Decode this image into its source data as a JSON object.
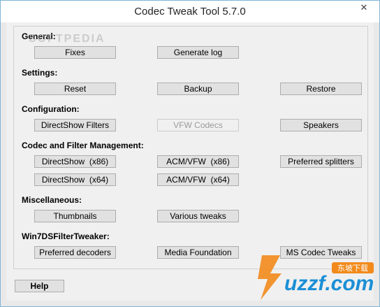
{
  "window": {
    "title": "Codec Tweak Tool 5.7.0",
    "close_glyph": "✕"
  },
  "sections": {
    "general": "General:",
    "settings": "Settings:",
    "configuration": "Configuration:",
    "codec_filter": "Codec and Filter Management:",
    "misc": "Miscellaneous:",
    "win7ds": "Win7DSFilterTweaker:"
  },
  "buttons": {
    "fixes": "Fixes",
    "generate_log": "Generate log",
    "reset": "Reset",
    "backup": "Backup",
    "restore": "Restore",
    "directshow_filters": "DirectShow Filters",
    "vfw_codecs": "VFW Codecs",
    "speakers": "Speakers",
    "directshow_x86": "DirectShow  (x86)",
    "acm_vfw_x86": "ACM/VFW  (x86)",
    "preferred_splitters": "Preferred splitters",
    "directshow_x64": "DirectShow  (x64)",
    "acm_vfw_x64": "ACM/VFW  (x64)",
    "thumbnails": "Thumbnails",
    "various_tweaks": "Various tweaks",
    "preferred_decoders": "Preferred decoders",
    "media_foundation": "Media Foundation",
    "ms_codec_tweaks": "MS Codec Tweaks",
    "help": "Help"
  },
  "watermarks": {
    "top": "SOFTPEDIA",
    "logo_text": "uzzf.com",
    "logo_cn": "东坡下载"
  },
  "colors": {
    "window_border": "#7fb5d8",
    "logo_orange": "#f28a1b",
    "logo_blue": "#1b8fd6"
  }
}
